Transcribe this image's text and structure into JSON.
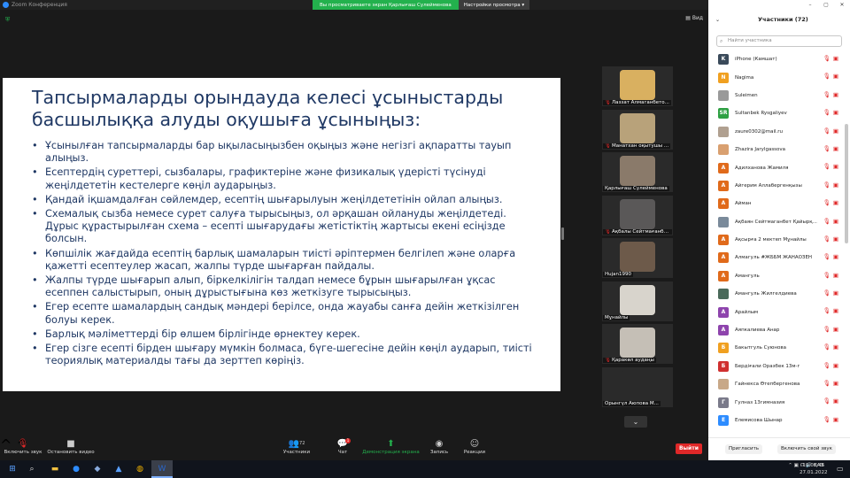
{
  "window": {
    "title": "Zoom Конференция",
    "share_banner": "Вы просматриваете экран Қарлығаш Сулейменова",
    "view_options": "Настройки просмотра",
    "view_button": "Вид"
  },
  "slide": {
    "heading": "Тапсырмаларды орындауда келесі ұсыныстарды басшылыққа алуды оқушыға ұсыныңыз:",
    "bullets": [
      "Ұсынылған тапсырмаларды бар ықыласыңызбен оқыңыз және негізгі ақпаратты тауып алыңыз.",
      "Есептердің суреттері, сызбалары, графиктеріне және физикалық үдерісті түсінуді жеңілдететін кестелерге көңіл аударыңыз.",
      "Қандай іқшамдалған сөйлемдер, есептің шығарылуын жеңілдететінін ойлап алыңыз.",
      "Схемалық сызба немесе сурет салуға тырысыңыз, ол әрқашан ойлануды жеңілдетеді. Дұрыс құрастырылған схема – есепті шығарудағы жетістіктің жартысы екені есіңізде болсын.",
      "Көпшілік жағдайда есептің барлық шамаларын тиісті әріптермен белгілеп және оларға қажетті есептеулер жасап, жалпы түрде шығарған пайдалы.",
      "Жалпы түрде шығарып алып, біркелкілігін талдап немесе бұрын шығарылған ұқсас есеппен салыстырып, оның дұрыстығына көз жеткізуге тырысыңыз.",
      "Егер есепте шамалардың сандық мәндері берілсе, онда жауабы санға дейін жеткізілген болуы керек.",
      "Барлық мәліметтерді бір өлшем бірлігінде өрнектеу керек.",
      "Егер сізге есепті бірден шығару мүмкін болмаса, бүге-шегесіне дейін көңіл аударып, тиісті теориялық материалды тағы да зерттеп көріңіз."
    ]
  },
  "thumbnails": [
    {
      "name": "Лаззат Алмаганбето...",
      "muted": true,
      "color": "#d9b060"
    },
    {
      "name": "Манатхан оқытушы ...",
      "muted": true,
      "color": "#b8a27a"
    },
    {
      "name": "Қарлығаш Сулейменова",
      "muted": false,
      "color": "#8a7a6a"
    },
    {
      "name": "Ақбалы Сейтмағанбе...",
      "muted": true,
      "color": "#5a5858"
    },
    {
      "name": "Hujan1990",
      "muted": false,
      "color": "#6d5a4a"
    },
    {
      "name": "Мұнайлы",
      "muted": false,
      "color": "#d8d4cc"
    },
    {
      "name": "Қаракөл аудаңы",
      "muted": true,
      "color": "#c5bfb6"
    },
    {
      "name": "Орынгүл Аюпова М...",
      "muted": false,
      "color": "#2a2a2a"
    }
  ],
  "toolbar": {
    "mic_label": "Включить звук",
    "video_label": "Остановить видео",
    "participants_label": "Участники",
    "participants_count": "72",
    "chat_label": "Чат",
    "chat_badge": "1",
    "share_label": "Демонстрация экрана",
    "record_label": "Запись",
    "reactions_label": "Реакции",
    "exit_label": "Выйти"
  },
  "panel": {
    "title": "Участники (72)",
    "search_placeholder": "Найти участника",
    "invite_label": "Пригласить",
    "unmute_me_label": "Включить свой звук",
    "participants": [
      {
        "name": "iPhone (Камшат)",
        "initial": "K",
        "color": "#3a4a5a"
      },
      {
        "name": "Nagima",
        "initial": "N",
        "color": "#f0a020"
      },
      {
        "name": "Suleimen",
        "initial": "",
        "color": "#9a9a9a"
      },
      {
        "name": "Sultanbek Rysgaliyev",
        "initial": "SR",
        "color": "#2ea043"
      },
      {
        "name": "zaure0302@mail.ru",
        "initial": "",
        "color": "#b0a090"
      },
      {
        "name": "Zhazira Jarylgassova",
        "initial": "",
        "color": "#d9a070"
      },
      {
        "name": "Адилханова Жамиля",
        "initial": "А",
        "color": "#e06a1b"
      },
      {
        "name": "Айгерим Аллабергенқызы",
        "initial": "А",
        "color": "#e06a1b"
      },
      {
        "name": "Айман",
        "initial": "А",
        "color": "#e06a1b"
      },
      {
        "name": "Ақбаян Сейтмаганбет Қайырқ...",
        "initial": "",
        "color": "#7a8a9a"
      },
      {
        "name": "Ақсырға 2 мектеп Мұнайлы",
        "initial": "А",
        "color": "#e06a1b"
      },
      {
        "name": "Алмагуль #ЖББМ ЖАНАОЗЕН",
        "initial": "А",
        "color": "#e06a1b"
      },
      {
        "name": "Амангуль",
        "initial": "А",
        "color": "#e06a1b"
      },
      {
        "name": "Амангуль Жилгелдиева",
        "initial": "",
        "color": "#4a6a5a"
      },
      {
        "name": "Арайлым",
        "initial": "А",
        "color": "#8e44ad"
      },
      {
        "name": "Аяпкалиева Анар",
        "initial": "А",
        "color": "#8e44ad"
      },
      {
        "name": "Бакытгуль Суюнова",
        "initial": "Б",
        "color": "#f0a020"
      },
      {
        "name": "Бердіғали Оразбек 13м-г",
        "initial": "Б",
        "color": "#d03030"
      },
      {
        "name": "Гайнекса Өтепбергенова",
        "initial": "",
        "color": "#c8a888"
      },
      {
        "name": "Гулназ 13гимназия",
        "initial": "Г",
        "color": "#7a7a8a"
      },
      {
        "name": "Елемисова Шынар",
        "initial": "Е",
        "color": "#2d8cff"
      }
    ]
  },
  "taskbar": {
    "language": "ҚАЗ",
    "time": "10:08:46",
    "date": "27.01.2022"
  }
}
